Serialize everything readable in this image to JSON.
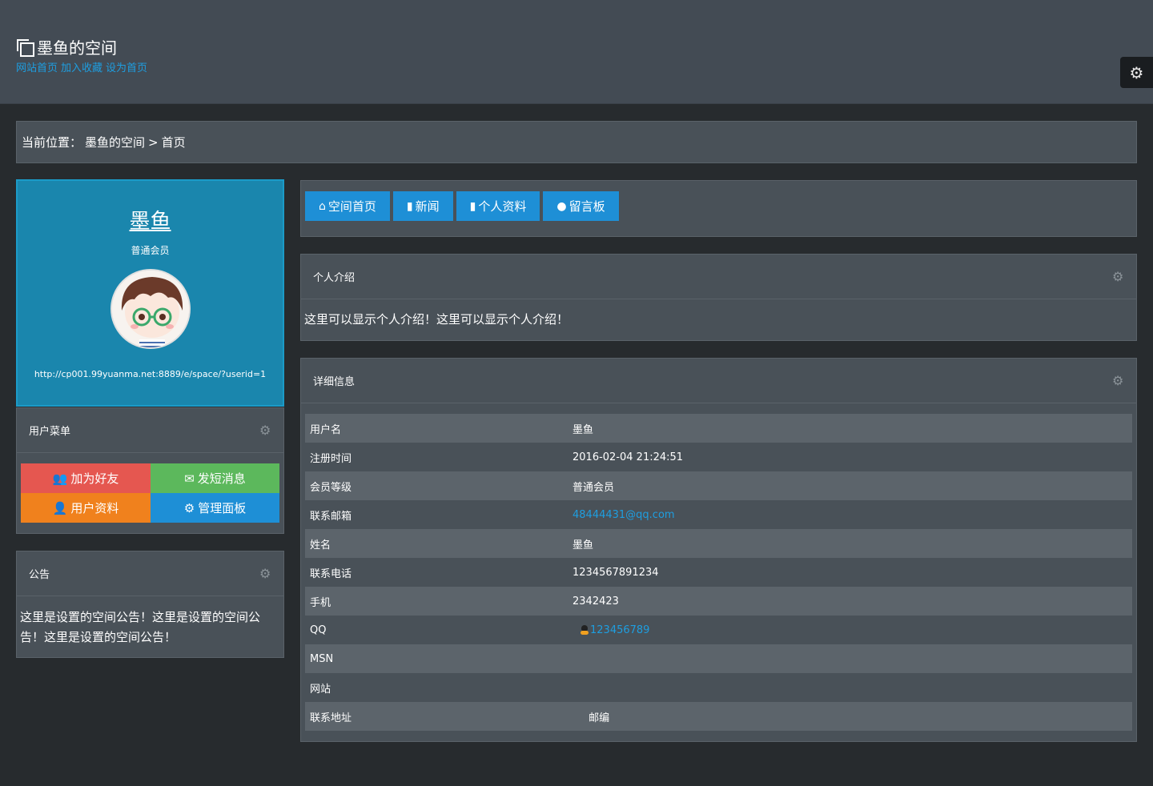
{
  "header": {
    "title": "墨鱼的空间",
    "links": [
      "网站首页",
      "加入收藏",
      "设为首页"
    ]
  },
  "breadcrumb": {
    "label": "当前位置：",
    "space": "墨鱼的空间",
    "separator": ">",
    "current": "首页"
  },
  "profile": {
    "name": "墨鱼",
    "level": "普通会员",
    "url": "http://cp001.99yuanma.net:8889/e/space/?userid=1"
  },
  "user_menu": {
    "title": "用户菜单",
    "buttons": [
      "加为好友",
      "发短消息",
      "用户资料",
      "管理面板"
    ]
  },
  "notice": {
    "title": "公告",
    "text": "这里是设置的空间公告！这里是设置的空间公告！这里是设置的空间公告！"
  },
  "nav": {
    "items": [
      "空间首页",
      "新闻",
      "个人资料",
      "留言板"
    ]
  },
  "intro": {
    "title": "个人介绍",
    "text": "这里可以显示个人介绍！这里可以显示个人介绍！"
  },
  "details": {
    "title": "详细信息",
    "rows": [
      {
        "label": "用户名",
        "value": "墨鱼"
      },
      {
        "label": "注册时间",
        "value": "2016-02-04 21:24:51"
      },
      {
        "label": "会员等级",
        "value": "普通会员"
      },
      {
        "label": "联系邮箱",
        "value": "48444431@qq.com"
      },
      {
        "label": "姓名",
        "value": "墨鱼"
      },
      {
        "label": "联系电话",
        "value": "1234567891234"
      },
      {
        "label": "手机",
        "value": "2342423"
      },
      {
        "label": "QQ",
        "value": "123456789"
      },
      {
        "label": "MSN",
        "value": ""
      },
      {
        "label": "网站",
        "value": ""
      },
      {
        "label": "联系地址",
        "value": "",
        "extra_label": "邮编"
      }
    ]
  },
  "colors": {
    "header_bg": "#434b54",
    "page_bg": "#272b2e",
    "panel_bg": "#495158",
    "profile_bg": "#1a86ad",
    "accent_blue": "#1e8fd6",
    "link_blue": "#1e9ee0",
    "red": "#e55750",
    "green": "#5cb85c",
    "orange": "#f0811d"
  }
}
